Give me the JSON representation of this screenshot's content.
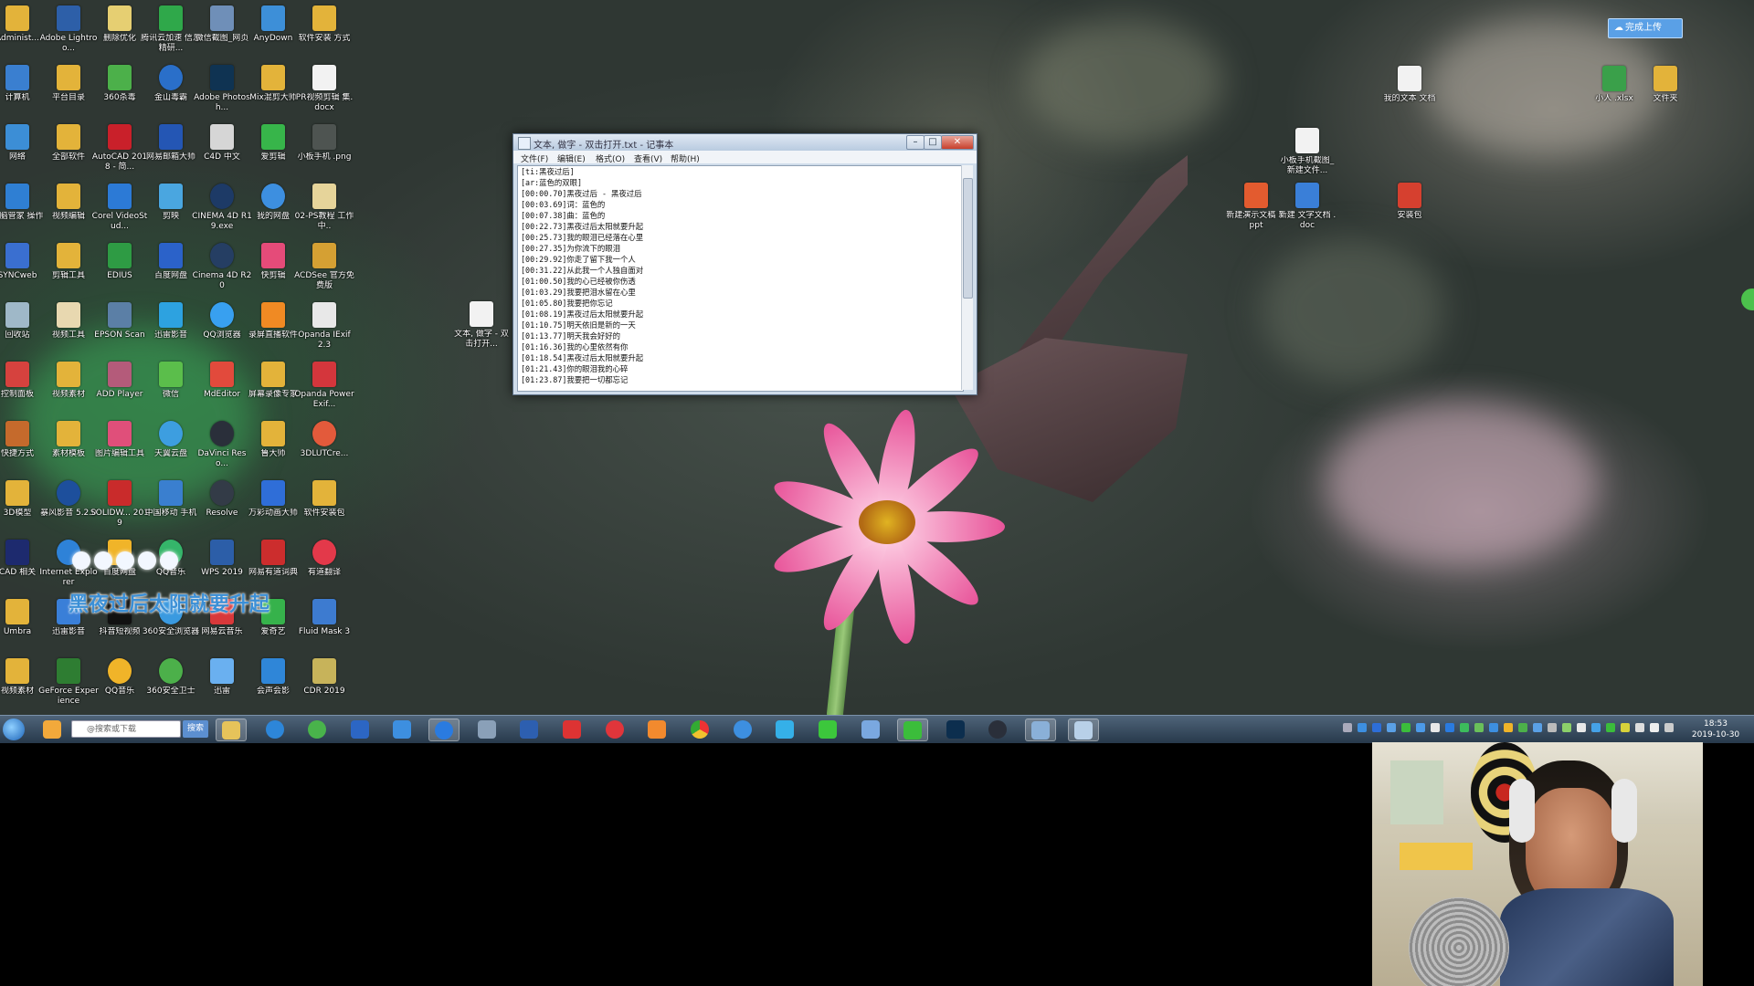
{
  "desktop": {
    "icons": [
      {
        "label": "Administ..."
      },
      {
        "label": "Adobe Lightroo..."
      },
      {
        "label": "删除优化"
      },
      {
        "label": "腾讯云加速 信息精研..."
      },
      {
        "label": "微信截图_网页"
      },
      {
        "label": "AnyDown"
      },
      {
        "label": "软件安装 方式"
      },
      {
        "label": "计算机"
      },
      {
        "label": "平台目录"
      },
      {
        "label": "360杀毒"
      },
      {
        "label": "金山毒霸"
      },
      {
        "label": "Adobe Photosh..."
      },
      {
        "label": "Mix混剪大师"
      },
      {
        "label": "PR视频剪辑 集.docx"
      },
      {
        "label": "网络"
      },
      {
        "label": "全部软件"
      },
      {
        "label": "AutoCAD 2018 - 简..."
      },
      {
        "label": "网易邮箱大师"
      },
      {
        "label": "C4D 中文"
      },
      {
        "label": "爱剪辑"
      },
      {
        "label": "小板手机 .png"
      },
      {
        "label": "电脑管家 操作"
      },
      {
        "label": "视频编辑"
      },
      {
        "label": "Corel VideoStud..."
      },
      {
        "label": "剪映"
      },
      {
        "label": "CINEMA 4D R19.exe"
      },
      {
        "label": "我的网盘"
      },
      {
        "label": "02-PS教程 工作中.."
      },
      {
        "label": "SYNCweb"
      },
      {
        "label": "剪辑工具"
      },
      {
        "label": "EDIUS"
      },
      {
        "label": "百度网盘"
      },
      {
        "label": "Cinema 4D R20"
      },
      {
        "label": "快剪辑"
      },
      {
        "label": "ACDSee 官方免费版"
      },
      {
        "label": "回收站"
      },
      {
        "label": "视频工具"
      },
      {
        "label": "EPSON Scan"
      },
      {
        "label": "迅雷影音"
      },
      {
        "label": "QQ浏览器"
      },
      {
        "label": "录屏直播软件"
      },
      {
        "label": "Opanda IExif 2.3"
      },
      {
        "label": "控制面板"
      },
      {
        "label": "视频素材"
      },
      {
        "label": "ADD Player"
      },
      {
        "label": "微信"
      },
      {
        "label": "MdEditor"
      },
      {
        "label": "屏幕录像专家"
      },
      {
        "label": "Opanda PowerExif..."
      },
      {
        "label": "快捷方式"
      },
      {
        "label": "素材模板"
      },
      {
        "label": "图片编辑工具"
      },
      {
        "label": "天翼云盘"
      },
      {
        "label": "DaVinci Reso..."
      },
      {
        "label": "鲁大师"
      },
      {
        "label": "3DLUTCre..."
      },
      {
        "label": "3D模型"
      },
      {
        "label": "暴风影音 5.2.0"
      },
      {
        "label": "SOLIDW... 2019"
      },
      {
        "label": "中国移动 手机"
      },
      {
        "label": "Resolve"
      },
      {
        "label": "万彩动画大师"
      },
      {
        "label": "软件安装包"
      },
      {
        "label": "CAD 相关"
      },
      {
        "label": "Internet Explorer"
      },
      {
        "label": "百度网盘"
      },
      {
        "label": "QQ音乐"
      },
      {
        "label": "WPS 2019"
      },
      {
        "label": "网易有道词典"
      },
      {
        "label": "有道翻译"
      },
      {
        "label": "Umbra"
      },
      {
        "label": "迅雷影音"
      },
      {
        "label": "抖音短视频"
      },
      {
        "label": "360安全浏览器"
      },
      {
        "label": "网易云音乐"
      },
      {
        "label": "爱奇艺"
      },
      {
        "label": "Fluid Mask 3"
      },
      {
        "label": "视频素材"
      },
      {
        "label": "GeForce Experience"
      },
      {
        "label": "QQ音乐"
      },
      {
        "label": "360安全卫士"
      },
      {
        "label": "迅雷"
      },
      {
        "label": "会声会影"
      },
      {
        "label": "CDR 2019"
      },
      {
        "label": "文本, 做字 - 双击打开..."
      },
      {
        "label": "我的文本 文档"
      },
      {
        "label": "小板手机截图_新建文件..."
      },
      {
        "label": "新建演示文稿 3.ppt"
      },
      {
        "label": "新建 文字文档 .doc"
      },
      {
        "label": "安装包"
      },
      {
        "label": "小人 .xlsx"
      },
      {
        "label": "文件夹"
      }
    ],
    "caption": "黑夜过后太阳就要升起",
    "upload_button": "完成上传"
  },
  "notepad": {
    "title": "文本, 做字 - 双击打开.txt - 记事本",
    "menu": [
      "文件(F)",
      "编辑(E)",
      "格式(O)",
      "查看(V)",
      "帮助(H)"
    ],
    "lines": [
      "[ti:黑夜过后]",
      "[ar:蓝色的双眼]",
      "[00:00.70]黑夜过后 - 黑夜过后",
      "[00:03.69]词：蓝色的",
      "[00:07.38]曲：蓝色的",
      "[00:22.73]黑夜过后太阳就要升起",
      "[00:25.73]我的眼泪已经落在心里",
      "[00:27.35]为你流下的眼泪",
      "[00:29.92]你走了留下我一个人",
      "[00:31.22]从此我一个人独自面对",
      "[01:00.50]我的心已经被你伤透",
      "[01:03.29]我要把泪水留在心里",
      "[01:05.80]我要把你忘记",
      "[01:08.19]黑夜过后太阳就要升起",
      "[01:10.75]明天依旧是新的一天",
      "[01:13.77]明天我会好好的",
      "[01:16.36]我的心里依然有你",
      "[01:18.54]黑夜过后太阳就要升起",
      "[01:21.43]你的眼泪我的心碎",
      "[01:23.87]我要把一切都忘记"
    ]
  },
  "taskbar": {
    "search_placeholder": "@搜索或下载",
    "search_button": "搜索",
    "clock_time": "18:53",
    "clock_date": "2019-10-30"
  }
}
